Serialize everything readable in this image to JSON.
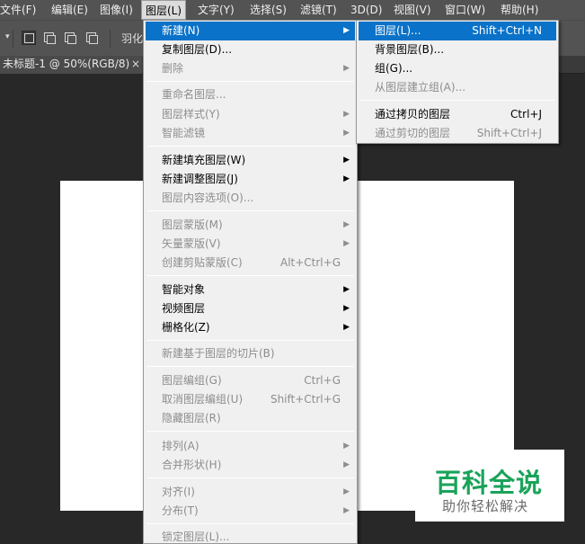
{
  "menubar": {
    "items": [
      {
        "label": "文件(F)",
        "active": false
      },
      {
        "label": "编辑(E)",
        "active": false
      },
      {
        "label": "图像(I)",
        "active": false
      },
      {
        "label": "图层(L)",
        "active": true
      },
      {
        "label": "文字(Y)",
        "active": false
      },
      {
        "label": "选择(S)",
        "active": false
      },
      {
        "label": "滤镜(T)",
        "active": false
      },
      {
        "label": "3D(D)",
        "active": false
      },
      {
        "label": "视图(V)",
        "active": false
      },
      {
        "label": "窗口(W)",
        "active": false
      },
      {
        "label": "帮助(H)",
        "active": false
      }
    ]
  },
  "options_bar": {
    "feather_label": "羽化"
  },
  "document": {
    "tab_label": "未标题-1 @ 50%(RGB/8)",
    "close_glyph": "×"
  },
  "layer_menu": {
    "items": [
      {
        "label": "新建(N)",
        "shortcut": "",
        "submenu": true,
        "disabled": false,
        "highlight": true
      },
      {
        "label": "复制图层(D)...",
        "shortcut": "",
        "submenu": false,
        "disabled": false,
        "highlight": false
      },
      {
        "label": "删除",
        "shortcut": "",
        "submenu": true,
        "disabled": true,
        "highlight": false
      },
      {
        "label": "重命名图层...",
        "shortcut": "",
        "submenu": false,
        "disabled": true,
        "highlight": false
      },
      {
        "label": "图层样式(Y)",
        "shortcut": "",
        "submenu": true,
        "disabled": true,
        "highlight": false
      },
      {
        "label": "智能滤镜",
        "shortcut": "",
        "submenu": true,
        "disabled": true,
        "highlight": false
      },
      {
        "label": "新建填充图层(W)",
        "shortcut": "",
        "submenu": true,
        "disabled": false,
        "highlight": false
      },
      {
        "label": "新建调整图层(J)",
        "shortcut": "",
        "submenu": true,
        "disabled": false,
        "highlight": false
      },
      {
        "label": "图层内容选项(O)...",
        "shortcut": "",
        "submenu": false,
        "disabled": true,
        "highlight": false
      },
      {
        "label": "图层蒙版(M)",
        "shortcut": "",
        "submenu": true,
        "disabled": true,
        "highlight": false
      },
      {
        "label": "矢量蒙版(V)",
        "shortcut": "",
        "submenu": true,
        "disabled": true,
        "highlight": false
      },
      {
        "label": "创建剪贴蒙版(C)",
        "shortcut": "Alt+Ctrl+G",
        "submenu": false,
        "disabled": true,
        "highlight": false
      },
      {
        "label": "智能对象",
        "shortcut": "",
        "submenu": true,
        "disabled": false,
        "highlight": false
      },
      {
        "label": "视频图层",
        "shortcut": "",
        "submenu": true,
        "disabled": false,
        "highlight": false
      },
      {
        "label": "栅格化(Z)",
        "shortcut": "",
        "submenu": true,
        "disabled": false,
        "highlight": false
      },
      {
        "label": "新建基于图层的切片(B)",
        "shortcut": "",
        "submenu": false,
        "disabled": true,
        "highlight": false
      },
      {
        "label": "图层编组(G)",
        "shortcut": "Ctrl+G",
        "submenu": false,
        "disabled": true,
        "highlight": false
      },
      {
        "label": "取消图层编组(U)",
        "shortcut": "Shift+Ctrl+G",
        "submenu": false,
        "disabled": true,
        "highlight": false
      },
      {
        "label": "隐藏图层(R)",
        "shortcut": "",
        "submenu": false,
        "disabled": true,
        "highlight": false
      },
      {
        "label": "排列(A)",
        "shortcut": "",
        "submenu": true,
        "disabled": true,
        "highlight": false
      },
      {
        "label": "合并形状(H)",
        "shortcut": "",
        "submenu": true,
        "disabled": true,
        "highlight": false
      },
      {
        "label": "对齐(I)",
        "shortcut": "",
        "submenu": true,
        "disabled": true,
        "highlight": false
      },
      {
        "label": "分布(T)",
        "shortcut": "",
        "submenu": true,
        "disabled": true,
        "highlight": false
      },
      {
        "label": "锁定图层(L)...",
        "shortcut": "",
        "submenu": false,
        "disabled": true,
        "highlight": false
      }
    ]
  },
  "new_submenu": {
    "items": [
      {
        "label": "图层(L)...",
        "shortcut": "Shift+Ctrl+N",
        "disabled": false,
        "highlight": true
      },
      {
        "label": "背景图层(B)...",
        "shortcut": "",
        "disabled": false,
        "highlight": false
      },
      {
        "label": "组(G)...",
        "shortcut": "",
        "disabled": false,
        "highlight": false
      },
      {
        "label": "从图层建立组(A)...",
        "shortcut": "",
        "disabled": true,
        "highlight": false
      },
      {
        "label": "通过拷贝的图层",
        "shortcut": "Ctrl+J",
        "disabled": false,
        "highlight": false
      },
      {
        "label": "通过剪切的图层",
        "shortcut": "Shift+Ctrl+J",
        "disabled": true,
        "highlight": false
      }
    ]
  },
  "glyphs": {
    "submenu_arrow": "▶",
    "dropdown_chevron": "▾"
  },
  "watermark": {
    "title": "百科全说",
    "subtitle": "助你轻松解决"
  },
  "colors": {
    "highlight": "#0a72c8",
    "menu_bg": "#f0f0f0",
    "disabled_text": "#8d8d8d",
    "watermark_green": "#1aa35a"
  }
}
